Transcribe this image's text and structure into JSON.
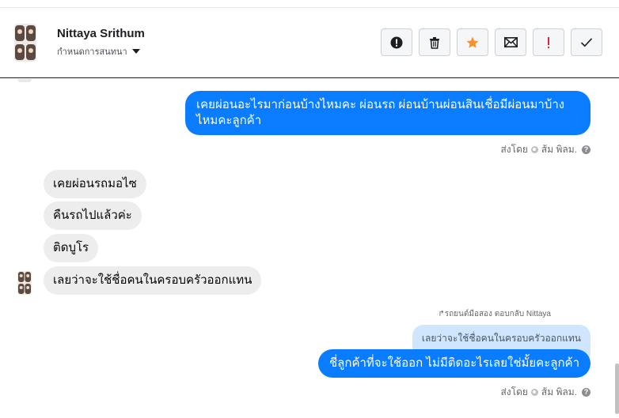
{
  "contact": {
    "name": "Nittaya Srithum",
    "subtitle": "กำหนดการสนทนา"
  },
  "toolbar": {
    "buttons": [
      {
        "name": "report-spam",
        "icon": "alert-circle-icon"
      },
      {
        "name": "delete",
        "icon": "trash-icon"
      },
      {
        "name": "star",
        "icon": "star-icon"
      },
      {
        "name": "mark-unread",
        "icon": "envelope-icon"
      },
      {
        "name": "follow-up",
        "icon": "exclamation-icon"
      },
      {
        "name": "mark-done",
        "icon": "checkmark-icon"
      }
    ],
    "accent_star": "#f5922f",
    "accent_follow": "#e41e3f"
  },
  "messages": {
    "out1": "เคยผ่อนอะไรมาก่อนบ้างไหมคะ ผ่อนรถ ผ่อนบ้านผ่อนสินเชื่อมีผ่อนมาบ้างไหมคะลูกค้า",
    "sent_by_1": "ส่งโดย",
    "sender_1": "ส้ม พิลม.",
    "in1": "เคยผ่อนรถมอไซ",
    "in2": "คืนรถไปแล้วค่ะ",
    "in3": "ติดบูโร",
    "in4": "เลยว่าจะใช้ชื่อคนในครอบครัวออกแทน",
    "reply_note": "รถยนต์มือสอง ตอบกลับ Nittaya",
    "quoted": "เลยว่าจะใช้ชื่อคนในครอบครัวออกแทน",
    "out2": "ชี่ลูกค้าที่จะใช้ออก ไม่มีติดอะไรเลยใช่มั้ยคะลูกค้า",
    "sent_by_2": "ส่งโดย",
    "sender_2": "ส้ม พิลม."
  },
  "colors": {
    "outgoing_bubble": "#0a7cff",
    "incoming_bubble": "#ededed",
    "quoted_bubble": "#cfe6fe"
  }
}
